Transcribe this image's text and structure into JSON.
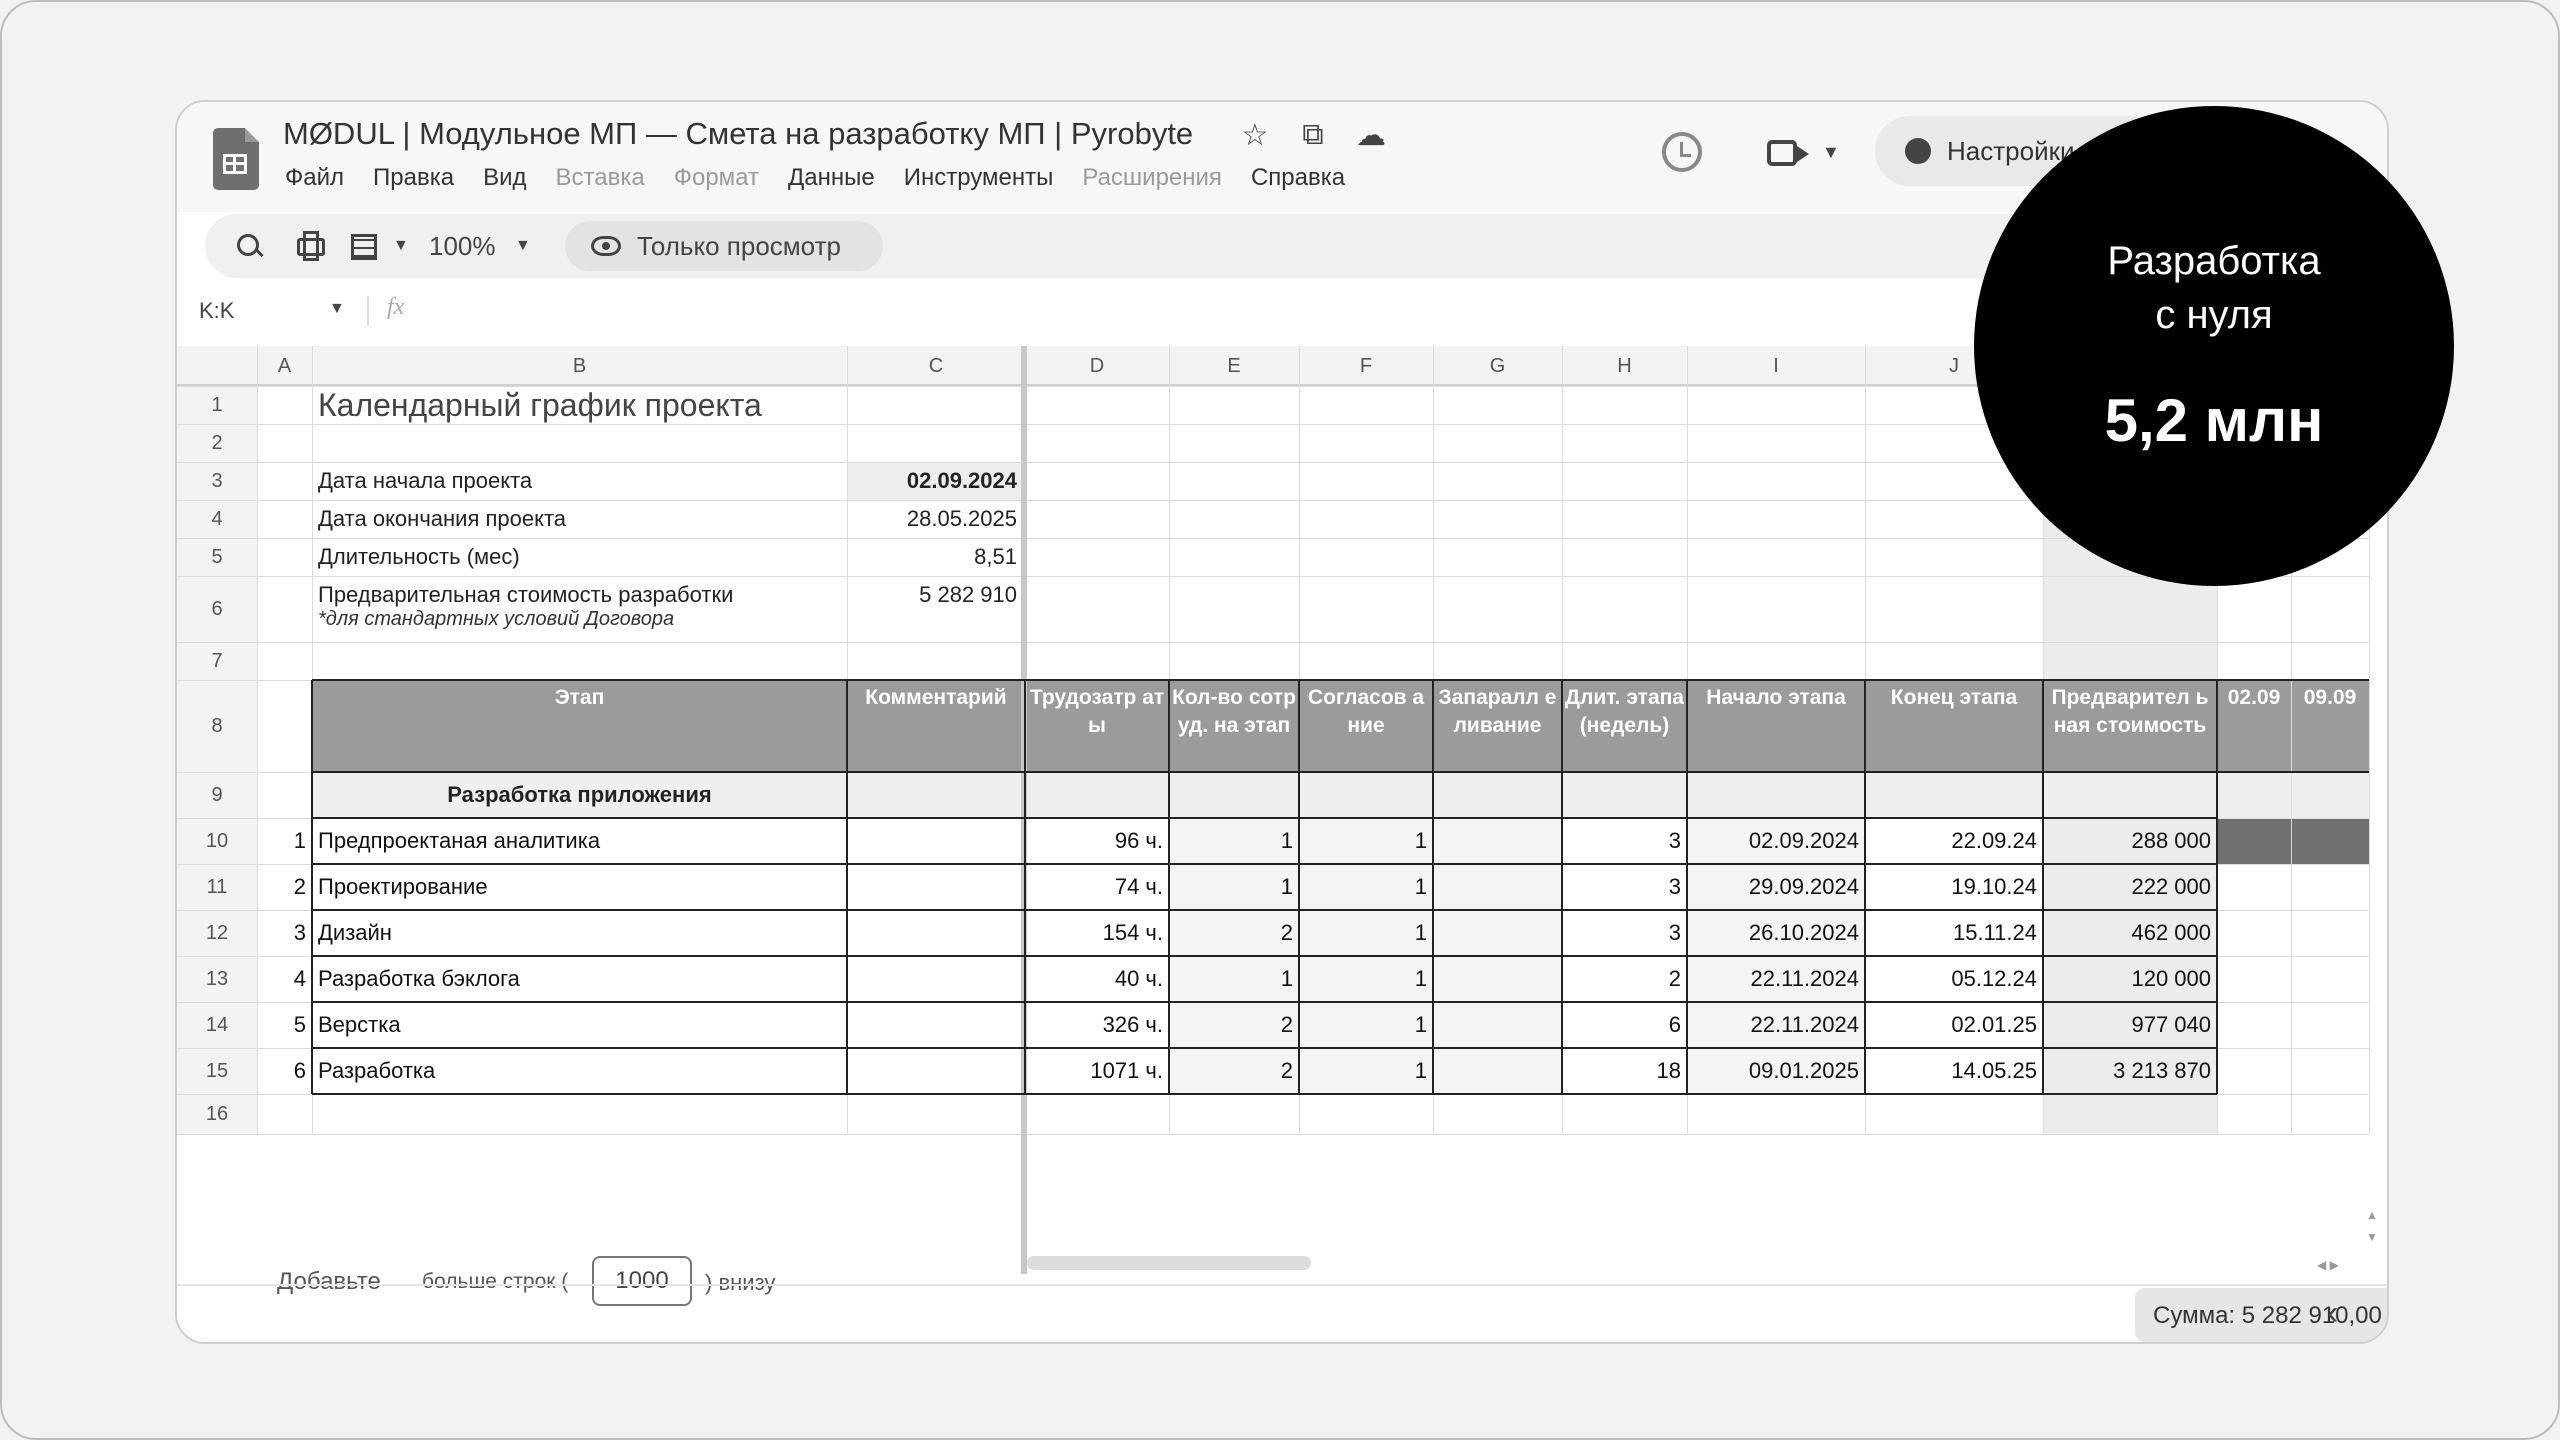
{
  "doc": {
    "title": "MØDUL | Модульное МП — Смета на разработку МП | Pyrobyte",
    "menu": [
      {
        "label": "Файл",
        "enabled": true
      },
      {
        "label": "Правка",
        "enabled": true
      },
      {
        "label": "Вид",
        "enabled": true
      },
      {
        "label": "Вставка",
        "enabled": false
      },
      {
        "label": "Формат",
        "enabled": false
      },
      {
        "label": "Данные",
        "enabled": true
      },
      {
        "label": "Инструменты",
        "enabled": true
      },
      {
        "label": "Расширения",
        "enabled": false
      },
      {
        "label": "Справка",
        "enabled": true
      }
    ],
    "settings_label": "Настройки",
    "title_icons": [
      "star-icon",
      "move-to-drive-icon",
      "cloud-status-icon"
    ]
  },
  "toolbar": {
    "zoom": "100%",
    "view_only": "Только просмотр"
  },
  "formula_bar": {
    "name_box": "K:K",
    "fx": "fx"
  },
  "sheet": {
    "columns": [
      "A",
      "B",
      "C",
      "D",
      "E",
      "F",
      "G",
      "H",
      "I",
      "J"
    ],
    "rows": [
      "1",
      "2",
      "3",
      "4",
      "5",
      "6",
      "7",
      "8",
      "9",
      "10",
      "11",
      "12",
      "13",
      "14",
      "15",
      "16"
    ],
    "title": "Календарный график проекта",
    "info": [
      {
        "label": "Дата начала проекта",
        "value": "02.09.2024"
      },
      {
        "label": "Дата окончания проекта",
        "value": "28.05.2025"
      },
      {
        "label": "Длительность (мес)",
        "value": "8,51"
      },
      {
        "label": "Предварительная стоимость разработки",
        "note": "*для стандартных условий Договора",
        "value": "5 282 910"
      }
    ],
    "headers": [
      "№",
      "Этап",
      "Комментарий",
      "Трудозатр аты",
      "Кол-во сотруд. на этап",
      "Согласов ание",
      "Запаралл еливание",
      "Длит. этапа (недель)",
      "Начало этапа",
      "Конец этапа",
      "Предварител ьная стоимость",
      "02.09",
      "09.09"
    ],
    "section": "Разработка приложения",
    "stages": [
      {
        "n": "1",
        "stage": "Предпроектаная аналитика",
        "hours": "96 ч.",
        "staff": "1",
        "approval": "1",
        "weeks": "3",
        "start": "02.09.2024",
        "end": "22.09.24",
        "cost": "288 000"
      },
      {
        "n": "2",
        "stage": "Проектирование",
        "hours": "74 ч.",
        "staff": "1",
        "approval": "1",
        "weeks": "3",
        "start": "29.09.2024",
        "end": "19.10.24",
        "cost": "222 000"
      },
      {
        "n": "3",
        "stage": "Дизайн",
        "hours": "154 ч.",
        "staff": "2",
        "approval": "1",
        "weeks": "3",
        "start": "26.10.2024",
        "end": "15.11.24",
        "cost": "462 000"
      },
      {
        "n": "4",
        "stage": "Разработка бэклога",
        "hours": "40 ч.",
        "staff": "1",
        "approval": "1",
        "weeks": "2",
        "start": "22.11.2024",
        "end": "05.12.24",
        "cost": "120 000"
      },
      {
        "n": "5",
        "stage": "Верстка",
        "hours": "326 ч.",
        "staff": "2",
        "approval": "1",
        "weeks": "6",
        "start": "22.11.2024",
        "end": "02.01.25",
        "cost": "977 040"
      },
      {
        "n": "6",
        "stage": "Разработка",
        "hours": "1071 ч.",
        "staff": "2",
        "approval": "1",
        "weeks": "18",
        "start": "09.01.2025",
        "end": "14.05.25",
        "cost": "3 213 870"
      }
    ]
  },
  "add_rows": {
    "prefix": "Добавьте",
    "middle": "больше строк (",
    "count": "1000",
    "suffix": ") внизу"
  },
  "status": {
    "sum": "Сумма: 5 282 910,00"
  },
  "badge": {
    "line1": "Разработка",
    "line2": "с нуля",
    "value": "5,2 млн"
  }
}
